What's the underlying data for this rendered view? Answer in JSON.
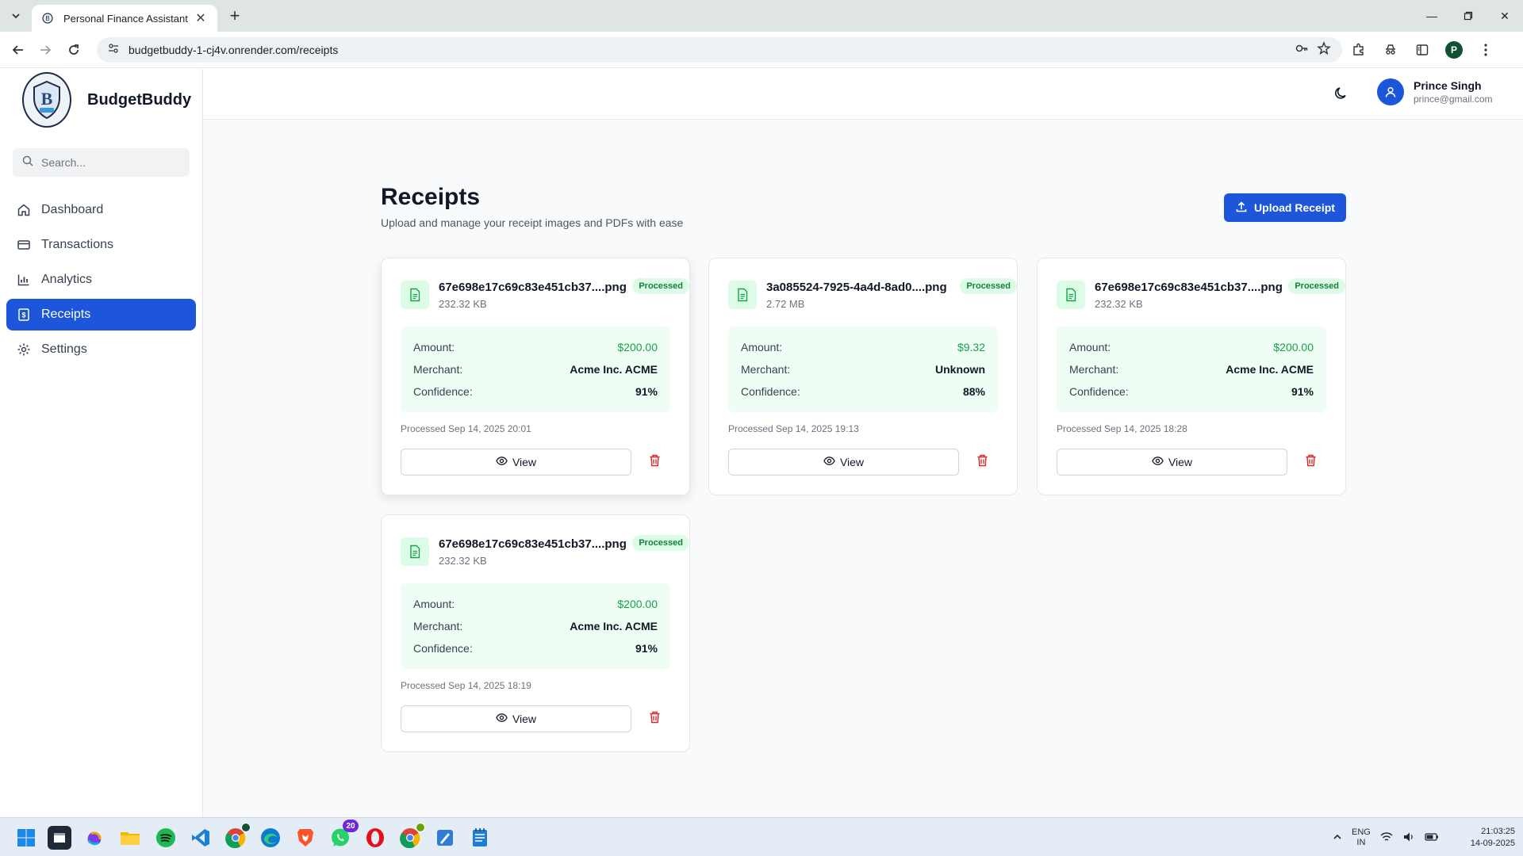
{
  "browser": {
    "tab_title": "Personal Finance Assistant",
    "url": "budgetbuddy-1-cj4v.onrender.com/receipts",
    "profile_initial": "P"
  },
  "app": {
    "brand": "BudgetBuddy",
    "search_placeholder": "Search...",
    "nav": [
      {
        "label": "Dashboard",
        "icon": "home-icon"
      },
      {
        "label": "Transactions",
        "icon": "credit-card-icon"
      },
      {
        "label": "Analytics",
        "icon": "bar-chart-icon"
      },
      {
        "label": "Receipts",
        "icon": "receipt-icon",
        "active": true
      },
      {
        "label": "Settings",
        "icon": "gear-icon"
      }
    ],
    "user": {
      "name": "Prince Singh",
      "email": "prince@gmail.com"
    }
  },
  "page": {
    "title": "Receipts",
    "subtitle": "Upload and manage your receipt images and PDFs with ease",
    "upload_label": "Upload Receipt"
  },
  "labels": {
    "amount": "Amount:",
    "merchant": "Merchant:",
    "confidence": "Confidence:",
    "view": "View"
  },
  "receipts": [
    {
      "file": "67e698e17c69c83e451cb37....png",
      "size": "232.32 KB",
      "status": "Processed",
      "amount": "$200.00",
      "merchant": "Acme Inc. ACME",
      "confidence": "91%",
      "processed": "Processed Sep 14, 2025 20:01"
    },
    {
      "file": "3a085524-7925-4a4d-8ad0....png",
      "size": "2.72 MB",
      "status": "Processed",
      "amount": "$9.32",
      "merchant": "Unknown",
      "confidence": "88%",
      "processed": "Processed Sep 14, 2025 19:13"
    },
    {
      "file": "67e698e17c69c83e451cb37....png",
      "size": "232.32 KB",
      "status": "Processed",
      "amount": "$200.00",
      "merchant": "Acme Inc. ACME",
      "confidence": "91%",
      "processed": "Processed Sep 14, 2025 18:28"
    },
    {
      "file": "67e698e17c69c83e451cb37....png",
      "size": "232.32 KB",
      "status": "Processed",
      "amount": "$200.00",
      "merchant": "Acme Inc. ACME",
      "confidence": "91%",
      "processed": "Processed Sep 14, 2025 18:19"
    }
  ],
  "taskbar": {
    "apps": [
      "start-icon",
      "terminal-icon",
      "copilot-icon",
      "file-explorer-icon",
      "spotify-icon",
      "vscode-icon",
      "chrome-icon",
      "edge-icon",
      "brave-icon",
      "whatsapp-icon",
      "opera-icon",
      "chrome-profile-icon",
      "paint-icon",
      "notepad-icon"
    ],
    "whatsapp_badge": "20",
    "lang_top": "ENG",
    "lang_bottom": "IN",
    "time": "21:03:25",
    "date": "14-09-2025"
  },
  "colors": {
    "primary": "#1d56db",
    "success": "#16a34a",
    "badge_bg": "#dcfce7",
    "danger": "#dc2626"
  }
}
